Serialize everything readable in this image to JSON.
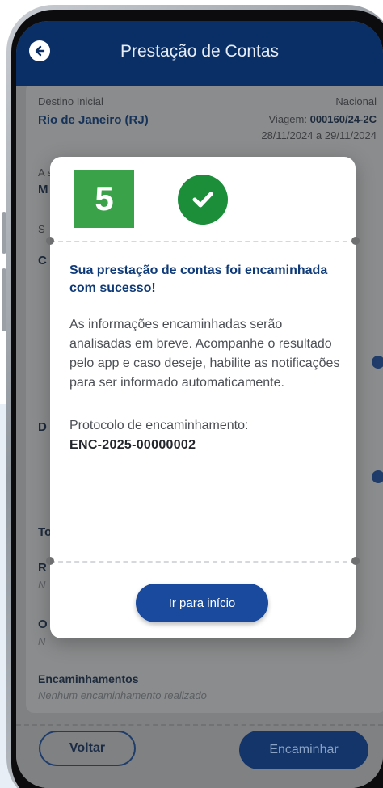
{
  "header": {
    "title": "Prestação de Contas",
    "back_icon": "arrow-left-icon"
  },
  "summary": {
    "origin_label": "Destino Inicial",
    "origin_value": "Rio de Janeiro (RJ)",
    "scope": "Nacional",
    "trip_label": "Viagem:",
    "trip_number": "000160/24-2C",
    "dates": "28/11/2024 a 29/11/2024",
    "service_label": "A serviço de",
    "service_value_partial": "M"
  },
  "background_fields": {
    "section_s": "S",
    "section_c": "C",
    "section_d": "D",
    "section_t": "To",
    "section_r": "R",
    "r_value_partial": "N",
    "section_o": "O",
    "o_value_partial": "N",
    "forwards_label": "Encaminhamentos",
    "forwards_value": "Nenhum encaminhamento realizado"
  },
  "footer": {
    "back_label": "Voltar",
    "forward_label": "Encaminhar"
  },
  "modal": {
    "step_number": "5",
    "check_icon": "check-circle-icon",
    "title": "Sua prestação de contas foi encaminhada com sucesso!",
    "body": "As informações encaminhadas serão analisadas em breve. Acompanhe o resultado pelo app e caso deseje, habilite as notificações para ser informado automaticamente.",
    "protocol_label": "Protocolo de encaminhamento:",
    "protocol_value": "ENC-2025-00000002",
    "home_button": "Ir para início"
  },
  "colors": {
    "header_bg": "#0a2f66",
    "modal_title": "#0f3a78",
    "step_badge": "#3aa34a",
    "success": "#1c8e3a",
    "primary_button": "#1a4a9e"
  }
}
